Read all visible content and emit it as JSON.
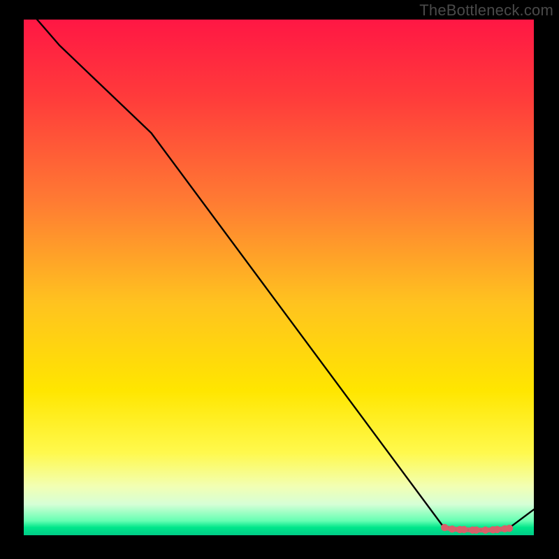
{
  "watermark": "TheBottleneck.com",
  "chart_data": {
    "type": "line",
    "title": "",
    "xlabel": "",
    "ylabel": "",
    "xlim": [
      0,
      100
    ],
    "ylim": [
      0,
      100
    ],
    "gradient_stops": [
      {
        "offset": 0.0,
        "color": "#ff1744"
      },
      {
        "offset": 0.15,
        "color": "#ff3b3b"
      },
      {
        "offset": 0.35,
        "color": "#ff7a33"
      },
      {
        "offset": 0.55,
        "color": "#ffc31f"
      },
      {
        "offset": 0.72,
        "color": "#ffe600"
      },
      {
        "offset": 0.84,
        "color": "#fff94d"
      },
      {
        "offset": 0.905,
        "color": "#f2ffb3"
      },
      {
        "offset": 0.94,
        "color": "#d6ffd6"
      },
      {
        "offset": 0.972,
        "color": "#66ffb3"
      },
      {
        "offset": 0.985,
        "color": "#00e68a"
      },
      {
        "offset": 1.0,
        "color": "#00cc88"
      }
    ],
    "series": [
      {
        "name": "curve",
        "x": [
          0,
          7,
          25,
          82,
          85,
          93,
          95,
          100
        ],
        "y": [
          103,
          95,
          78,
          2,
          1,
          1,
          1.3,
          5
        ],
        "style": "line"
      },
      {
        "name": "markers",
        "x": [
          82.5,
          84,
          85.5,
          86.3,
          88.0,
          88.7,
          90.5,
          92.0,
          92.8,
          94.3,
          95.2
        ],
        "y": [
          1.5,
          1.2,
          1.1,
          1.1,
          1.0,
          1.0,
          1.0,
          1.05,
          1.1,
          1.25,
          1.35
        ],
        "style": "points"
      }
    ],
    "marker_color": "#d9606a",
    "line_color": "#000000"
  }
}
